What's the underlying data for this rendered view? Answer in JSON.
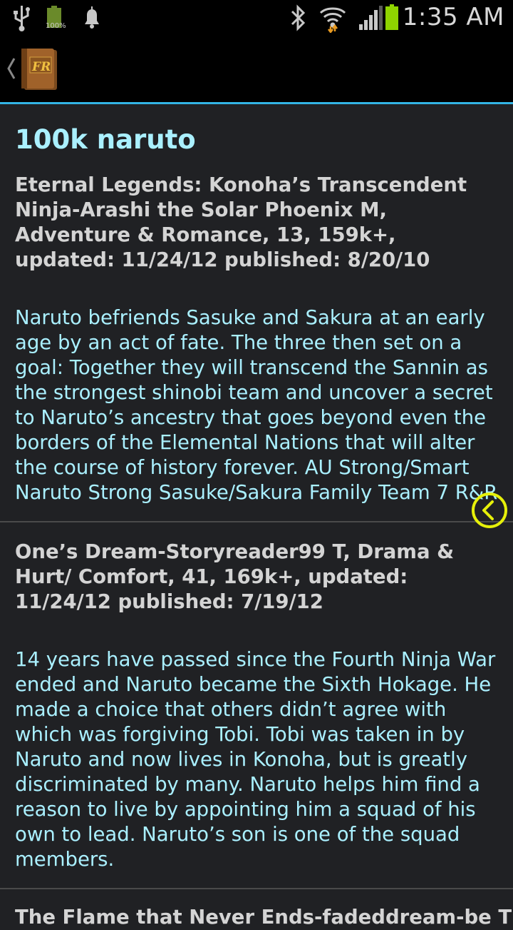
{
  "status_bar": {
    "battery_label": "100%",
    "time": "1:35 AM"
  },
  "action_bar": {
    "app_icon_text": "FR"
  },
  "page": {
    "title": "100k naruto"
  },
  "stories": [
    {
      "meta": "Eternal Legends: Konoha’s Transcendent Ninja-Arashi the Solar Phoenix M, Adventure & Romance, 13, 159k+, updated: 11/24/12 published: 8/20/10",
      "summary": "Naruto befriends Sasuke and Sakura at an early age by an act of fate. The three then set on a goal: Together they will transcend the Sannin as the strongest shinobi team and uncover a secret to Naruto’s ancestry that goes beyond even the borders of the Elemental Nations that will alter the course of history forever. AU Strong/Smart Naruto Strong Sasuke/Sakura Family Team 7 R&R"
    },
    {
      "meta": "One’s Dream-Storyreader99 T, Drama & Hurt/ Comfort, 41, 169k+, updated: 11/24/12 published: 7/19/12",
      "summary": "14 years have passed since the Fourth Ninja War ended and Naruto became the Sixth Hokage. He made a choice that others didn’t agree with which was forgiving Tobi. Tobi was taken in by Naruto and now lives in Konoha, but is greatly discriminated by many. Naruto helps him find a reason to live by appointing him a squad of his own to lead. Naruto’s son is one of the squad members."
    },
    {
      "meta": "The Flame that Never Ends-fadeddream-be T"
    }
  ],
  "colors": {
    "accent": "#33b5e5",
    "title_cyan": "#aaf0ff",
    "meta_gray": "#d4d4d4",
    "background": "#202124",
    "float_button": "#e6f00a"
  }
}
